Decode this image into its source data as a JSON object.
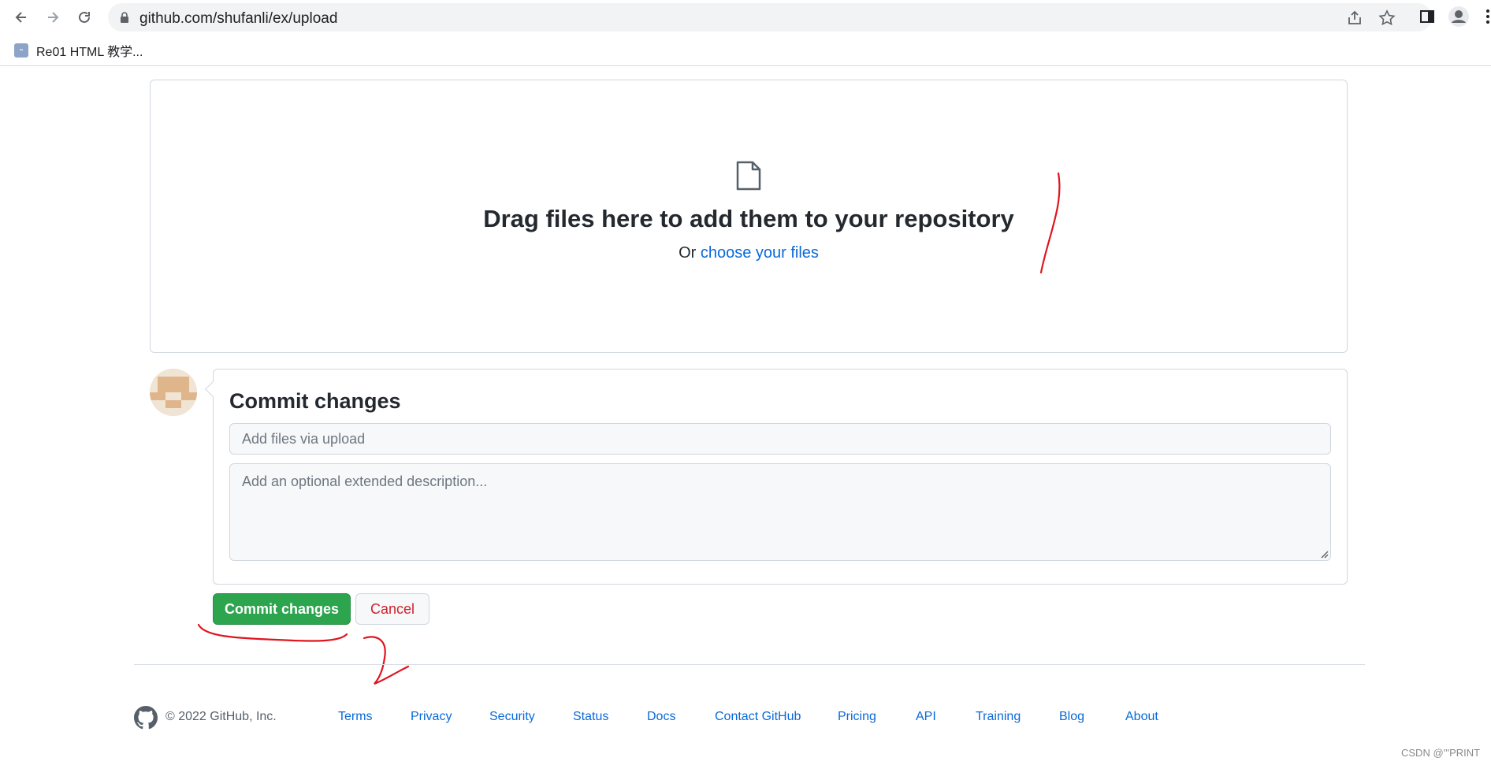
{
  "browser": {
    "url": "github.com/shufanli/ex/upload",
    "bookmarks": [
      {
        "label": "Re01 HTML 教学..."
      }
    ]
  },
  "upload": {
    "title": "Drag files here to add them to your repository",
    "prefix": "Or",
    "link": "choose your files"
  },
  "commit": {
    "heading": "Commit changes",
    "summary_placeholder": "Add files via upload",
    "summary_value": "",
    "description_placeholder": "Add an optional extended description...",
    "description_value": "",
    "commit_button": "Commit changes",
    "cancel_button": "Cancel"
  },
  "footer": {
    "copyright": "© 2022 GitHub, Inc.",
    "links": [
      "Terms",
      "Privacy",
      "Security",
      "Status",
      "Docs",
      "Contact GitHub",
      "Pricing",
      "API",
      "Training",
      "Blog",
      "About"
    ]
  },
  "watermark": "CSDN @'''PRINT",
  "colors": {
    "primary_button": "#2da44e",
    "link": "#0969da",
    "danger": "#cf222e",
    "annotation": "#e0141e"
  }
}
